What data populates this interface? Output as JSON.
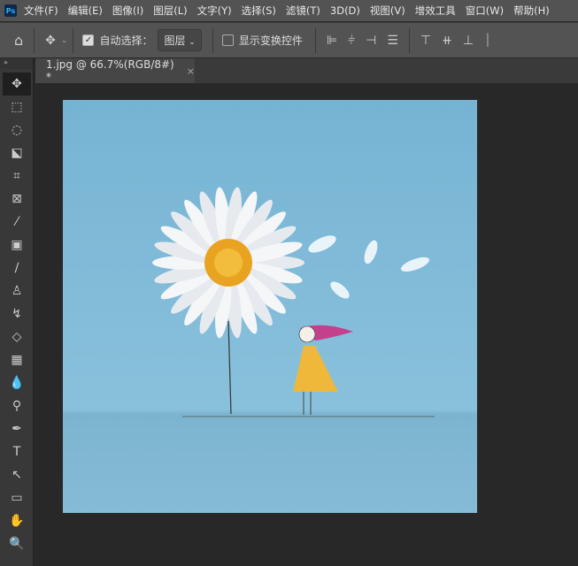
{
  "app": {
    "logo": "Ps"
  },
  "menu": [
    "文件(F)",
    "编辑(E)",
    "图像(I)",
    "图层(L)",
    "文字(Y)",
    "选择(S)",
    "滤镜(T)",
    "3D(D)",
    "视图(V)",
    "增效工具",
    "窗口(W)",
    "帮助(H)"
  ],
  "options": {
    "auto_select_label": "自动选择：",
    "auto_select_checked": true,
    "auto_select_target": "图层",
    "show_transform_label": "显示变换控件",
    "show_transform_checked": false
  },
  "document_tab": {
    "title": "1.jpg @ 66.7%(RGB/8#) *",
    "close": "×"
  },
  "tools": [
    {
      "name": "move-tool",
      "glyph": "✥"
    },
    {
      "name": "marquee-tool",
      "glyph": "⬚"
    },
    {
      "name": "lasso-tool",
      "glyph": "◌"
    },
    {
      "name": "object-select-tool",
      "glyph": "⬕"
    },
    {
      "name": "crop-tool",
      "glyph": "⌗"
    },
    {
      "name": "frame-tool",
      "glyph": "⊠"
    },
    {
      "name": "eyedropper-tool",
      "glyph": "⁄"
    },
    {
      "name": "healing-tool",
      "glyph": "▣"
    },
    {
      "name": "brush-tool",
      "glyph": "∕"
    },
    {
      "name": "stamp-tool",
      "glyph": "♙"
    },
    {
      "name": "history-brush-tool",
      "glyph": "↯"
    },
    {
      "name": "eraser-tool",
      "glyph": "◇"
    },
    {
      "name": "gradient-tool",
      "glyph": "▦"
    },
    {
      "name": "blur-tool",
      "glyph": "💧"
    },
    {
      "name": "dodge-tool",
      "glyph": "⚲"
    },
    {
      "name": "pen-tool",
      "glyph": "✒"
    },
    {
      "name": "type-tool",
      "glyph": "T"
    },
    {
      "name": "path-select-tool",
      "glyph": "↖"
    },
    {
      "name": "rectangle-tool",
      "glyph": "▭"
    },
    {
      "name": "hand-tool",
      "glyph": "✋"
    },
    {
      "name": "zoom-tool",
      "glyph": "🔍"
    }
  ]
}
